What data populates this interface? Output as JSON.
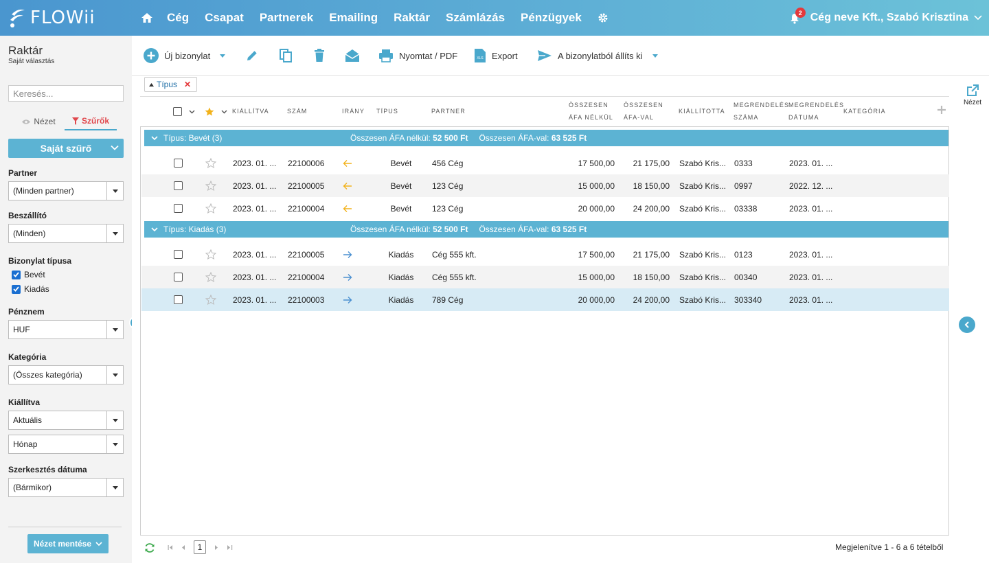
{
  "brand": {
    "name": "FLOWii"
  },
  "nav": {
    "items": [
      "Cég",
      "Csapat",
      "Partnerek",
      "Emailing",
      "Raktár",
      "Számlázás",
      "Pénzügyek"
    ]
  },
  "user": {
    "notifications": "2",
    "label": "Cég neve Kft., Szabó Krisztina"
  },
  "sidebar": {
    "title": "Raktár",
    "subtitle": "Saját választás",
    "search_placeholder": "Keresés...",
    "tab_view": "Nézet",
    "tab_filters": "Szűrők",
    "own_filter": "Saját szűrő",
    "partner_label": "Partner",
    "partner_value": "(Minden partner)",
    "supplier_label": "Beszállító",
    "supplier_value": "(Minden)",
    "doctype_label": "Bizonylat típusa",
    "doctype_options": [
      "Bevét",
      "Kiadás"
    ],
    "currency_label": "Pénznem",
    "currency_value": "HUF",
    "category_label": "Kategória",
    "category_value": "(Összes kategória)",
    "issued_label": "Kiállítva",
    "issued_value": "Aktuális",
    "issued_period": "Hónap",
    "edited_label": "Szerkesztés dátuma",
    "edited_value": "(Bármikor)",
    "save_view": "Nézet mentése"
  },
  "toolbar": {
    "new_doc": "Új bizonylat",
    "print": "Nyomtat / PDF",
    "export": "Export",
    "issue_from": "A bizonylatból állíts ki"
  },
  "filter_chip": {
    "label": "Típus"
  },
  "columns": {
    "issued": "Kiállítva",
    "number": "Szám",
    "direction": "Irány",
    "type": "Típus",
    "partner": "Partner",
    "net_1": "Összesen",
    "net_2": "ÁFA nélkül",
    "gross_1": "Összesen",
    "gross_2": "ÁFA-val",
    "issuer": "Kiállította",
    "order_no_1": "Megrendelés",
    "order_no_2": "száma",
    "order_date_1": "Megrendelés",
    "order_date_2": "dátuma",
    "category": "Kategória"
  },
  "groups": [
    {
      "title": "Típus: Bevét (3)",
      "sum_net_label": "Összesen ÁFA nélkül:",
      "sum_net_value": "52 500 Ft",
      "sum_gross_label": "Összesen ÁFA-val:",
      "sum_gross_value": "63 525 Ft",
      "rows": [
        {
          "issued": "2023. 01. ...",
          "number": "22100006",
          "direction": "in",
          "type": "Bevét",
          "partner": "456 Cég",
          "net": "17 500,00",
          "gross": "21 175,00",
          "issuer": "Szabó Kris...",
          "order_no": "0333",
          "order_date": "2023. 01. ..."
        },
        {
          "issued": "2023. 01. ...",
          "number": "22100005",
          "direction": "in",
          "type": "Bevét",
          "partner": "123 Cég",
          "net": "15 000,00",
          "gross": "18 150,00",
          "issuer": "Szabó Kris...",
          "order_no": "0997",
          "order_date": "2022. 12. ..."
        },
        {
          "issued": "2023. 01. ...",
          "number": "22100004",
          "direction": "in",
          "type": "Bevét",
          "partner": "123 Cég",
          "net": "20 000,00",
          "gross": "24 200,00",
          "issuer": "Szabó Kris...",
          "order_no": "03338",
          "order_date": "2023. 01. ..."
        }
      ]
    },
    {
      "title": "Típus: Kiadás (3)",
      "sum_net_label": "Összesen ÁFA nélkül:",
      "sum_net_value": "52 500 Ft",
      "sum_gross_label": "Összesen ÁFA-val:",
      "sum_gross_value": "63 525 Ft",
      "rows": [
        {
          "issued": "2023. 01. ...",
          "number": "22100005",
          "direction": "out",
          "type": "Kiadás",
          "partner": "Cég 555 kft.",
          "net": "17 500,00",
          "gross": "21 175,00",
          "issuer": "Szabó Kris...",
          "order_no": "0123",
          "order_date": "2023. 01. ..."
        },
        {
          "issued": "2023. 01. ...",
          "number": "22100004",
          "direction": "out",
          "type": "Kiadás",
          "partner": "Cég 555 kft.",
          "net": "15 000,00",
          "gross": "18 150,00",
          "issuer": "Szabó Kris...",
          "order_no": "00340",
          "order_date": "2023. 01. ..."
        },
        {
          "issued": "2023. 01. ...",
          "number": "22100003",
          "direction": "out",
          "type": "Kiadás",
          "partner": "789 Cég",
          "net": "20 000,00",
          "gross": "24 200,00",
          "issuer": "Szabó Kris...",
          "order_no": "303340",
          "order_date": "2023. 01. ..."
        }
      ]
    }
  ],
  "footer": {
    "page": "1",
    "status": "Megjelenítve 1 - 6 a 6 tételből"
  },
  "right_panel": {
    "view_label": "Nézet"
  },
  "colors": {
    "accent": "#5cb3d3",
    "in_arrow": "#f2b21b",
    "out_arrow": "#4a8fd0",
    "filter_red": "#e0474c"
  }
}
